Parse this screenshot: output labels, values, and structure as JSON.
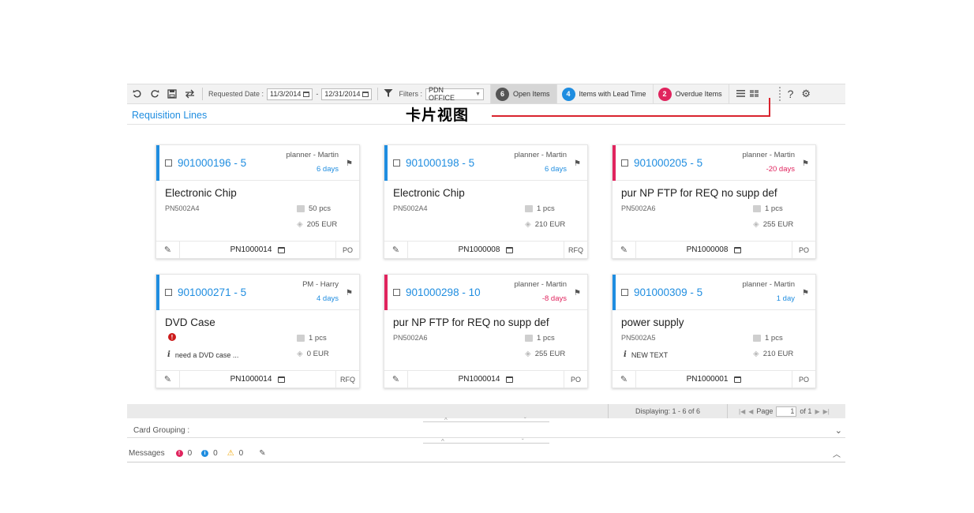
{
  "toolbar": {
    "requested_date_label": "Requested Date :",
    "date_from": "11/3/2014",
    "date_separator": "-",
    "date_to": "12/31/2014",
    "filters_label": "Filters :",
    "filter_value": "PDN OFFICE",
    "open_items": {
      "count": "6",
      "label": "Open Items",
      "color": "#555555"
    },
    "lead_time_items": {
      "count": "4",
      "label": "Items with Lead Time",
      "color": "#1f8de0"
    },
    "overdue_items": {
      "count": "2",
      "label": "Overdue Items",
      "color": "#e0245e"
    },
    "help_label": "?"
  },
  "page_title": "Requisition Lines",
  "annotation": "卡片视图",
  "cards": [
    {
      "id": "901000196 - 5",
      "planner": "planner - Martin",
      "days": "6 days",
      "days_color": "#1f8de0",
      "stripe": "#1f8de0",
      "name": "Electronic Chip",
      "part": "PN5002A4",
      "qty": "50 pcs",
      "price": "205 EUR",
      "order": "PN1000014",
      "type": "PO",
      "note": "",
      "alert": false
    },
    {
      "id": "901000198 - 5",
      "planner": "planner - Martin",
      "days": "6 days",
      "days_color": "#1f8de0",
      "stripe": "#1f8de0",
      "name": "Electronic Chip",
      "part": "PN5002A4",
      "qty": "1 pcs",
      "price": "210 EUR",
      "order": "PN1000008",
      "type": "RFQ",
      "note": "",
      "alert": false
    },
    {
      "id": "901000205 - 5",
      "planner": "planner - Martin",
      "days": "-20 days",
      "days_color": "#e0245e",
      "stripe": "#e0245e",
      "name": "pur NP FTP for REQ no supp def",
      "part": "PN5002A6",
      "qty": "1 pcs",
      "price": "255 EUR",
      "order": "PN1000008",
      "type": "PO",
      "note": "",
      "alert": false
    },
    {
      "id": "901000271 - 5",
      "planner": "PM - Harry",
      "days": "4 days",
      "days_color": "#1f8de0",
      "stripe": "#1f8de0",
      "name": "DVD Case",
      "part": "",
      "qty": "1 pcs",
      "price": "0 EUR",
      "order": "PN1000014",
      "type": "RFQ",
      "note": "need a DVD case ...",
      "alert": true
    },
    {
      "id": "901000298 - 10",
      "planner": "planner - Martin",
      "days": "-8 days",
      "days_color": "#e0245e",
      "stripe": "#e0245e",
      "name": "pur NP FTP for REQ no supp def",
      "part": "PN5002A6",
      "qty": "1 pcs",
      "price": "255 EUR",
      "order": "PN1000014",
      "type": "PO",
      "note": "",
      "alert": false
    },
    {
      "id": "901000309 - 5",
      "planner": "planner - Martin",
      "days": "1 day",
      "days_color": "#1f8de0",
      "stripe": "#1f8de0",
      "name": "power supply",
      "part": "PN5002A5",
      "qty": "1 pcs",
      "price": "210 EUR",
      "order": "PN1000001",
      "type": "PO",
      "note": "NEW TEXT",
      "alert": false
    }
  ],
  "pager": {
    "displaying": "Displaying: 1 - 6 of 6",
    "page_label": "Page",
    "page_value": "1",
    "of_label": "of 1"
  },
  "card_grouping_label": "Card Grouping :",
  "messages": {
    "label": "Messages",
    "errors": "0",
    "infos": "0",
    "warnings": "0"
  }
}
